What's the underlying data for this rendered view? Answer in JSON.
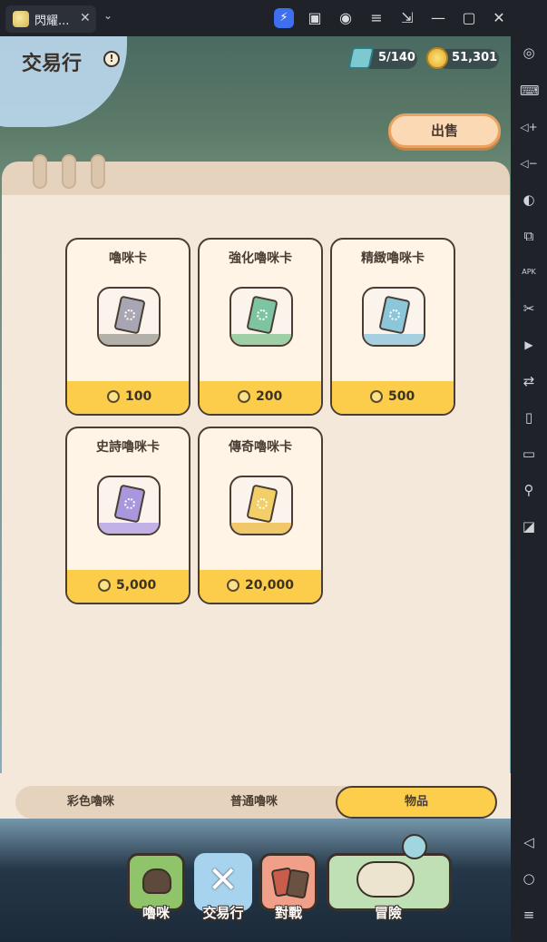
{
  "window": {
    "tab_title": "閃耀...",
    "tab_close": "✕",
    "tab_dropdown": "⌄",
    "toolbar_icons": [
      "bolt-icon",
      "gift-icon",
      "account-icon",
      "menu-icon",
      "screenshot-icon",
      "minimize-icon",
      "maximize-icon",
      "close-icon"
    ],
    "toolbar_glyphs": [
      "⚡",
      "▣",
      "◉",
      "≡",
      "⇲",
      "—",
      "▢",
      "✕"
    ],
    "expand_glyph": "«"
  },
  "sidebar": {
    "icons": [
      "settings-icon",
      "keyboard-icon",
      "volume-up-icon",
      "volume-down-icon",
      "record-icon",
      "multi-instance-icon",
      "apk-icon",
      "cut-icon",
      "video-icon",
      "sync-icon",
      "shake-icon",
      "folder-icon",
      "location-icon",
      "operations-icon"
    ],
    "glyphs": [
      "◎",
      "⌨",
      "◁+",
      "◁−",
      "◐",
      "⧉",
      "APK",
      "✂",
      "▶",
      "⇄",
      "▯",
      "▭",
      "⚲",
      "◪"
    ],
    "nav_glyphs": [
      "◁",
      "○",
      "≡"
    ]
  },
  "header": {
    "title": "交易行",
    "info_glyph": "!",
    "tickets": "5/140",
    "coins": "51,301"
  },
  "sell_button": "出售",
  "items": [
    {
      "name": "嚕咪卡",
      "price": "100",
      "color": "#a8a6b3"
    },
    {
      "name": "強化嚕咪卡",
      "price": "200",
      "color": "#7fc4a2"
    },
    {
      "name": "精緻嚕咪卡",
      "price": "500",
      "color": "#8cc6da"
    },
    {
      "name": "史詩嚕咪卡",
      "price": "5,000",
      "color": "#a997dd"
    },
    {
      "name": "傳奇嚕咪卡",
      "price": "20,000",
      "color": "#f3cf69"
    }
  ],
  "tabs": {
    "items": [
      "彩色嚕咪",
      "普通嚕咪",
      "物品"
    ],
    "active": "物品"
  },
  "bottom_nav": [
    {
      "label": "嚕咪",
      "color": "#8fc46a"
    },
    {
      "label": "交易行",
      "color": "#a7d3ef"
    },
    {
      "label": "對戰",
      "color": "#f0a089"
    },
    {
      "label": "冒險",
      "color": "#bfe0b4"
    }
  ]
}
